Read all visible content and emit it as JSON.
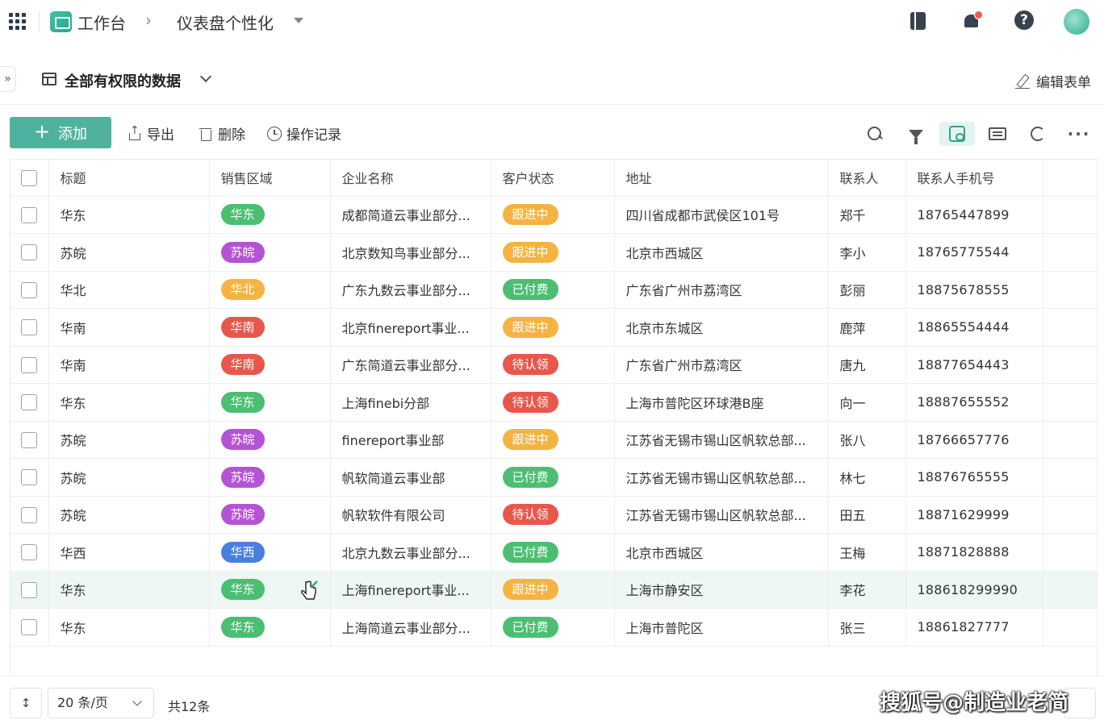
{
  "topbar": {
    "app_name": "工作台",
    "crumb_sep": "›",
    "dashboard": "仪表盘个性化"
  },
  "viewbar": {
    "expand": "»",
    "view_name": "全部有权限的数据",
    "edit_form": "编辑表单"
  },
  "toolbar": {
    "add": "添加",
    "export": "导出",
    "delete": "删除",
    "history": "操作记录"
  },
  "table": {
    "columns": [
      "标题",
      "销售区域",
      "企业名称",
      "客户状态",
      "地址",
      "联系人",
      "联系人手机号"
    ],
    "rows": [
      {
        "title": "华东",
        "region": "华东",
        "region_color": "#4cbe72",
        "company": "成都简道云事业部分...",
        "status": "跟进中",
        "status_color": "#f5b342",
        "address": "四川省成都市武侯区101号",
        "contact": "郑千",
        "phone": "18765447899"
      },
      {
        "title": "苏皖",
        "region": "苏皖",
        "region_color": "#b553d6",
        "company": "北京数知鸟事业部分...",
        "status": "跟进中",
        "status_color": "#f5b342",
        "address": "北京市西城区",
        "contact": "李小",
        "phone": "18765775544"
      },
      {
        "title": "华北",
        "region": "华北",
        "region_color": "#f5b342",
        "company": "广东九数云事业部分...",
        "status": "已付费",
        "status_color": "#4cbe72",
        "address": "广东省广州市荔湾区",
        "contact": "彭丽",
        "phone": "18875678555"
      },
      {
        "title": "华南",
        "region": "华南",
        "region_color": "#e8574c",
        "company": "北京finereport事业...",
        "status": "跟进中",
        "status_color": "#f5b342",
        "address": "北京市东城区",
        "contact": "鹿萍",
        "phone": "18865554444"
      },
      {
        "title": "华南",
        "region": "华南",
        "region_color": "#e8574c",
        "company": "广东简道云事业部分...",
        "status": "待认领",
        "status_color": "#e8574c",
        "address": "广东省广州市荔湾区",
        "contact": "唐九",
        "phone": "18877654443"
      },
      {
        "title": "华东",
        "region": "华东",
        "region_color": "#4cbe72",
        "company": "上海finebi分部",
        "status": "待认领",
        "status_color": "#e8574c",
        "address": "上海市普陀区环球港B座",
        "contact": "向一",
        "phone": "18887655552"
      },
      {
        "title": "苏皖",
        "region": "苏皖",
        "region_color": "#b553d6",
        "company": "finereport事业部",
        "status": "跟进中",
        "status_color": "#f5b342",
        "address": "江苏省无锡市锡山区帆软总部...",
        "contact": "张八",
        "phone": "18766657776"
      },
      {
        "title": "苏皖",
        "region": "苏皖",
        "region_color": "#b553d6",
        "company": "帆软简道云事业部",
        "status": "已付费",
        "status_color": "#4cbe72",
        "address": "江苏省无锡市锡山区帆软总部...",
        "contact": "林七",
        "phone": "18876765555"
      },
      {
        "title": "苏皖",
        "region": "苏皖",
        "region_color": "#b553d6",
        "company": "帆软软件有限公司",
        "status": "待认领",
        "status_color": "#e8574c",
        "address": "江苏省无锡市锡山区帆软总部...",
        "contact": "田五",
        "phone": "18871629999"
      },
      {
        "title": "华西",
        "region": "华西",
        "region_color": "#4a7fe0",
        "company": "北京九数云事业部分...",
        "status": "已付费",
        "status_color": "#4cbe72",
        "address": "北京市西城区",
        "contact": "王梅",
        "phone": "18871828888"
      },
      {
        "title": "华东",
        "region": "华东",
        "region_color": "#4cbe72",
        "company": "上海finereport事业...",
        "status": "跟进中",
        "status_color": "#f5b342",
        "address": "上海市静安区",
        "contact": "李花",
        "phone": "188618299990"
      },
      {
        "title": "华东",
        "region": "华东",
        "region_color": "#4cbe72",
        "company": "上海简道云事业部分...",
        "status": "已付费",
        "status_color": "#4cbe72",
        "address": "上海市普陀区",
        "contact": "张三",
        "phone": "18861827777"
      }
    ]
  },
  "footer": {
    "toggle": "↕",
    "page_size": "20 条/页",
    "total": "共12条"
  },
  "watermark": "搜狐号@制造业老简",
  "colors": {
    "accent": "#4fb29e",
    "hover_row": "#eef7f4"
  }
}
